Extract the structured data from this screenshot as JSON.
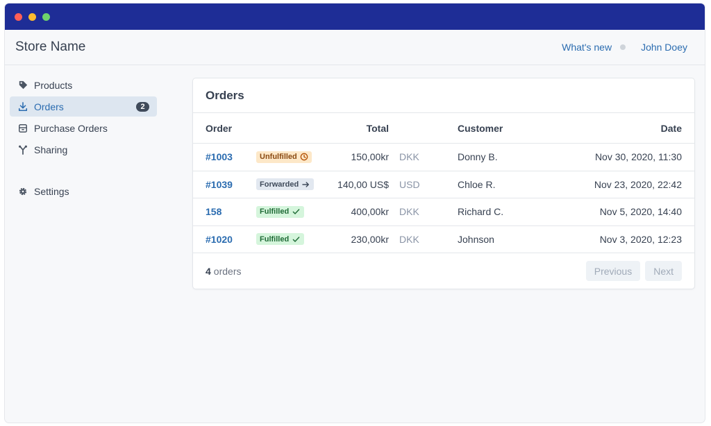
{
  "window": {
    "controls": [
      {
        "name": "close",
        "color": "#ff5f57"
      },
      {
        "name": "minimize",
        "color": "#febc2e"
      },
      {
        "name": "zoom",
        "color": "#28c840"
      }
    ],
    "titlebar_color": "#1e2d96"
  },
  "header": {
    "store_name": "Store Name",
    "whats_new": "What's new",
    "user_name": "John Doey"
  },
  "sidebar": {
    "items": [
      {
        "label": "Products",
        "icon": "tag-icon"
      },
      {
        "label": "Orders",
        "icon": "download-icon",
        "badge": "2",
        "active": true
      },
      {
        "label": "Purchase Orders",
        "icon": "archive-icon"
      },
      {
        "label": "Sharing",
        "icon": "share-icon"
      }
    ],
    "settings": {
      "label": "Settings",
      "icon": "gear-icon"
    }
  },
  "orders": {
    "title": "Orders",
    "columns": {
      "order": "Order",
      "total": "Total",
      "customer": "Customer",
      "date": "Date"
    },
    "rows": [
      {
        "order": "#1003",
        "status": "Unfulfilled",
        "status_icon": "clock-icon",
        "total": "150,00kr",
        "currency": "DKK",
        "customer": "Donny B.",
        "date": "Nov 30, 2020, 11:30"
      },
      {
        "order": "#1039",
        "status": "Forwarded",
        "status_icon": "arrow-right-icon",
        "total": "140,00 US$",
        "currency": "USD",
        "customer": "Chloe R.",
        "date": "Nov 23, 2020, 22:42"
      },
      {
        "order": "158",
        "status": "Fulfilled",
        "status_icon": "check-icon",
        "total": "400,00kr",
        "currency": "DKK",
        "customer": "Richard C.",
        "date": "Nov 5, 2020, 14:40"
      },
      {
        "order": "#1020",
        "status": "Fulfilled",
        "status_icon": "check-icon",
        "total": "230,00kr",
        "currency": "DKK",
        "customer": "Johnson",
        "date": "Nov 3, 2020, 12:23"
      }
    ],
    "footer": {
      "count": "4",
      "count_suffix": "orders",
      "previous": "Previous",
      "next": "Next"
    }
  }
}
